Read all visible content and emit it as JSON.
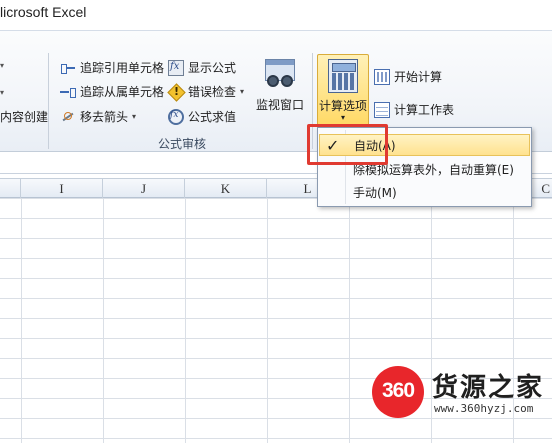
{
  "window": {
    "title": "licrosoft Excel"
  },
  "ribbon": {
    "left_partial_label": "内容创建",
    "formula_auditing": {
      "group_label": "公式审核",
      "trace_precedents": "追踪引用单元格",
      "trace_dependents": "追踪从属单元格",
      "remove_arrows": "移去箭头",
      "show_formulas": "显示公式",
      "error_checking": "错误检查",
      "evaluate_formula": "公式求值",
      "watch_window": "监视窗口"
    },
    "calculation": {
      "options": "计算选项",
      "calculate_now": "开始计算",
      "calculate_sheet": "计算工作表"
    }
  },
  "grid": {
    "columns": [
      "I",
      "J",
      "K",
      "L",
      "",
      "",
      "C"
    ]
  },
  "menu": {
    "items": [
      {
        "label": "自动(A)",
        "checked": true
      },
      {
        "label": "除模拟运算表外，自动重算(E)",
        "checked": false
      },
      {
        "label": "手动(M)",
        "checked": false
      }
    ],
    "check_glyph": "✓"
  },
  "watermark": {
    "logo_text": "360",
    "site_name": "货源之家",
    "url": "www.360hyzj.com"
  },
  "colors": {
    "highlight": "#ffe28f",
    "annotation": "#e03a31",
    "logo": "#e8262b"
  }
}
